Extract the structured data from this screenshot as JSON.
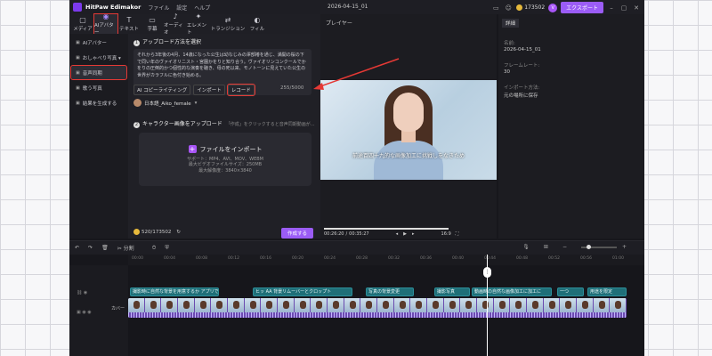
{
  "app": {
    "name": "HitPaw Edimakor",
    "menu": [
      "ファイル",
      "設定",
      "ヘルプ"
    ],
    "project": "2026-04-15_01",
    "credits": "173502",
    "export_label": "エクスポート"
  },
  "toolbar": {
    "items": [
      {
        "label": "メディア",
        "icon": "▢"
      },
      {
        "label": "AIアバター",
        "icon": "◉"
      },
      {
        "label": "テキスト",
        "icon": "T"
      },
      {
        "label": "字幕",
        "icon": "▭"
      },
      {
        "label": "オーディオ",
        "icon": "♪"
      },
      {
        "label": "エレメント",
        "icon": "✦"
      },
      {
        "label": "トランジション",
        "icon": "⇄"
      },
      {
        "label": "フィル",
        "icon": "◐"
      }
    ]
  },
  "sidebar": {
    "items": [
      {
        "label": "AIアバター",
        "icon": "▣"
      },
      {
        "label": "おしゃべり写真 ▾",
        "icon": "▣"
      },
      {
        "label": "音声同期",
        "icon": "▣"
      },
      {
        "label": "歌う写真",
        "icon": "▣"
      },
      {
        "label": "結果を生成する",
        "icon": "▣"
      }
    ]
  },
  "panel": {
    "step1_num": "1",
    "step1_title": "アップロード方法を選択",
    "script_text": "それから3年後の4月、14歳になった公生は幼なじみの澤部椿を通じ、満開の桜の下で同い年のヴァイオリニスト・宮園かをりと知り合う。ヴァイオリンコンクールでかをりの圧倒的かつ個性的な演奏を聴き、母の死以来、モノトーンに見えていた公生の世界がカラフルに色付き始める。",
    "tab_ai": "AI コピーライティング",
    "tab_import": "インポート",
    "tab_record": "レコード",
    "char_count": "255/5000",
    "voice": "日本語_Aiko_female",
    "step2_num": "2",
    "step2_title": "キャラクター画像をアップロード",
    "step2_hint": "「作成」をクリックすると音声同期動画が...",
    "import_label": "ファイルをインポート",
    "support": "サポート：MP4、AVI、MOV、WEBM",
    "maxsize": "最大ビデオファイルサイズ：250MB",
    "maxres": "最大解像度：3840×3840",
    "balance": "520/173502",
    "generate": "作成する"
  },
  "player": {
    "title": "プレイヤー",
    "subtitle": "前途百四十九的な画像加工に挑戦しをなきため",
    "time_current": "00:26:20",
    "time_total": "00:35:27",
    "ratio": "16:9"
  },
  "properties": {
    "tab": "詳細",
    "name_label": "名前:",
    "name_value": "2026-04-15_01",
    "fps_label": "フレームレート:",
    "fps_value": "30",
    "import_label": "インポート方法:",
    "import_value": "元の場所に保存"
  },
  "timeline": {
    "split": "分割",
    "ruler": [
      "00:00",
      "00:04",
      "00:08",
      "00:12",
      "00:16",
      "00:20",
      "00:24",
      "00:28",
      "00:32",
      "00:36",
      "00:40",
      "00:44",
      "00:48",
      "00:52",
      "00:56",
      "01:00"
    ],
    "cover": "カバー",
    "clips": [
      "撮影時に自然な背景を用意するか アプリで",
      "ヒッ AA 背景リムーバーとクロップト",
      "写真の背景変更",
      "撮影写真",
      "動画時の自然な画像加工に加工に",
      "一つ ",
      "用途を限定"
    ]
  },
  "colors": {
    "accent": "#9b5cf6",
    "highlight": "#e53935",
    "clip": "#1f6f78",
    "video_track": "#6b4bb0"
  }
}
